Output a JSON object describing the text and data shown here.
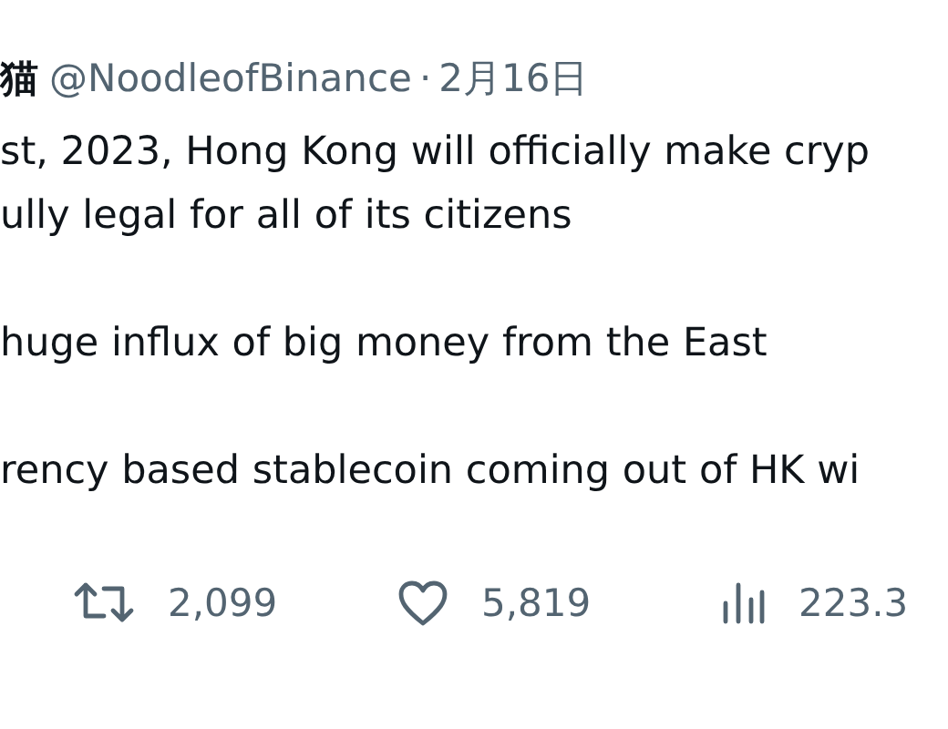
{
  "header": {
    "name": "猫",
    "handle": "@NoodleofBinance",
    "separator": "·",
    "date": "2月16日"
  },
  "body": [
    [
      "st, 2023, Hong Kong will officially make cryp",
      "ully legal for all of its citizens"
    ],
    [
      "huge influx of big money from the East"
    ],
    [
      "rency based stablecoin coming out of HK wi"
    ]
  ],
  "stats": [
    {
      "kind": "retweet",
      "count": "2,099"
    },
    {
      "kind": "like",
      "count": "5,819"
    },
    {
      "kind": "views",
      "count": "223.3"
    }
  ]
}
